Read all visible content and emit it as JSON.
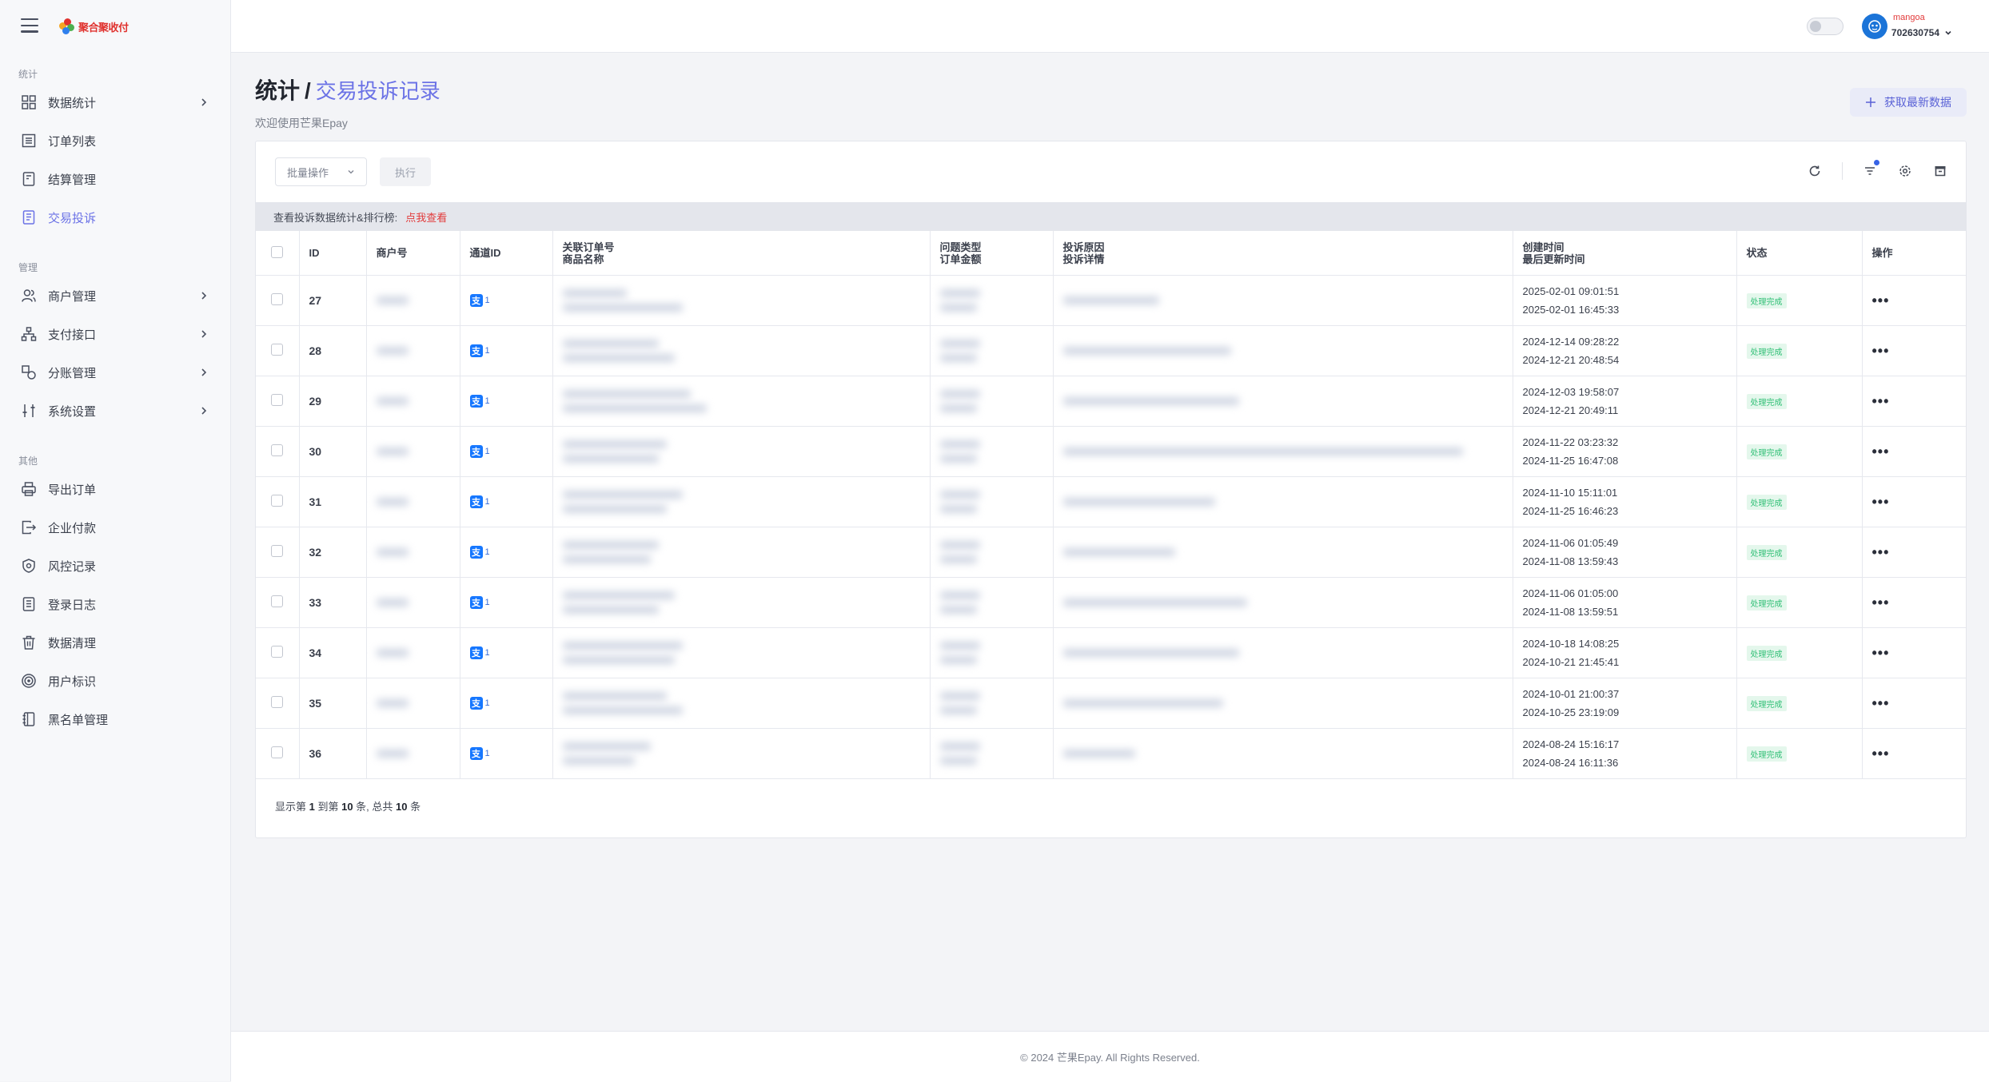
{
  "brand": {
    "logo_text": "聚合聚收付"
  },
  "sidebar": {
    "sections": [
      {
        "title": "统计",
        "items": [
          {
            "label": "数据统计",
            "icon": "grid-icon",
            "has_children": true
          },
          {
            "label": "订单列表",
            "icon": "list-icon",
            "has_children": false
          },
          {
            "label": "结算管理",
            "icon": "settlement-icon",
            "has_children": false
          },
          {
            "label": "交易投诉",
            "icon": "complaint-icon",
            "has_children": false,
            "active": true
          }
        ]
      },
      {
        "title": "管理",
        "items": [
          {
            "label": "商户管理",
            "icon": "users-icon",
            "has_children": true
          },
          {
            "label": "支付接口",
            "icon": "network-icon",
            "has_children": true
          },
          {
            "label": "分账管理",
            "icon": "shapes-icon",
            "has_children": true
          },
          {
            "label": "系统设置",
            "icon": "sliders-icon",
            "has_children": true
          }
        ]
      },
      {
        "title": "其他",
        "items": [
          {
            "label": "导出订单",
            "icon": "printer-icon",
            "has_children": false
          },
          {
            "label": "企业付款",
            "icon": "payout-icon",
            "has_children": false
          },
          {
            "label": "风控记录",
            "icon": "shield-icon",
            "has_children": false
          },
          {
            "label": "登录日志",
            "icon": "log-icon",
            "has_children": false
          },
          {
            "label": "数据清理",
            "icon": "trash-icon",
            "has_children": false
          },
          {
            "label": "用户标识",
            "icon": "target-icon",
            "has_children": false
          },
          {
            "label": "黑名单管理",
            "icon": "notebook-icon",
            "has_children": false
          }
        ]
      }
    ]
  },
  "header": {
    "user_name": "mangoa",
    "user_id": "702630754"
  },
  "page": {
    "title": "统计",
    "breadcrumb": "交易投诉记录",
    "subtitle": "欢迎使用芒果Epay",
    "refresh_label": "获取最新数据"
  },
  "toolbar": {
    "bulk_label": "批量操作",
    "exec_label": "执行"
  },
  "notice": {
    "text": "查看投诉数据统计&排行榜:",
    "link": "点我查看"
  },
  "table": {
    "headers": {
      "id": "ID",
      "merchant": "商户号",
      "channel": "通道ID",
      "order_l1": "关联订单号",
      "order_l2": "商品名称",
      "type_l1": "问题类型",
      "type_l2": "订单金额",
      "reason_l1": "投诉原因",
      "reason_l2": "投诉详情",
      "time_l1": "创建时间",
      "time_l2": "最后更新时间",
      "status": "状态",
      "actions": "操作"
    },
    "rows": [
      {
        "id": "27",
        "channel": "1",
        "created": "2025-02-01 09:01:51",
        "updated": "2025-02-01 16:45:33",
        "status": "处理完成"
      },
      {
        "id": "28",
        "channel": "1",
        "created": "2024-12-14 09:28:22",
        "updated": "2024-12-21 20:48:54",
        "status": "处理完成"
      },
      {
        "id": "29",
        "channel": "1",
        "created": "2024-12-03 19:58:07",
        "updated": "2024-12-21 20:49:11",
        "status": "处理完成"
      },
      {
        "id": "30",
        "channel": "1",
        "created": "2024-11-22 03:23:32",
        "updated": "2024-11-25 16:47:08",
        "status": "处理完成"
      },
      {
        "id": "31",
        "channel": "1",
        "created": "2024-11-10 15:11:01",
        "updated": "2024-11-25 16:46:23",
        "status": "处理完成"
      },
      {
        "id": "32",
        "channel": "1",
        "created": "2024-11-06 01:05:49",
        "updated": "2024-11-08 13:59:43",
        "status": "处理完成"
      },
      {
        "id": "33",
        "channel": "1",
        "created": "2024-11-06 01:05:00",
        "updated": "2024-11-08 13:59:51",
        "status": "处理完成"
      },
      {
        "id": "34",
        "channel": "1",
        "created": "2024-10-18 14:08:25",
        "updated": "2024-10-21 21:45:41",
        "status": "处理完成"
      },
      {
        "id": "35",
        "channel": "1",
        "created": "2024-10-01 21:00:37",
        "updated": "2024-10-25 23:19:09",
        "status": "处理完成"
      },
      {
        "id": "36",
        "channel": "1",
        "created": "2024-08-24 15:16:17",
        "updated": "2024-08-24 16:11:36",
        "status": "处理完成"
      }
    ],
    "summary_parts": [
      "显示第 ",
      "1",
      " 到第 ",
      "10",
      " 条, 总共 ",
      "10",
      " 条"
    ]
  },
  "footer": {
    "text": "© 2024 芒果Epay. All Rights Reserved."
  },
  "colors": {
    "accent": "#6b72e6",
    "danger": "#e23a3a",
    "success": "#2fbf75",
    "avatar": "#1b74d8"
  }
}
